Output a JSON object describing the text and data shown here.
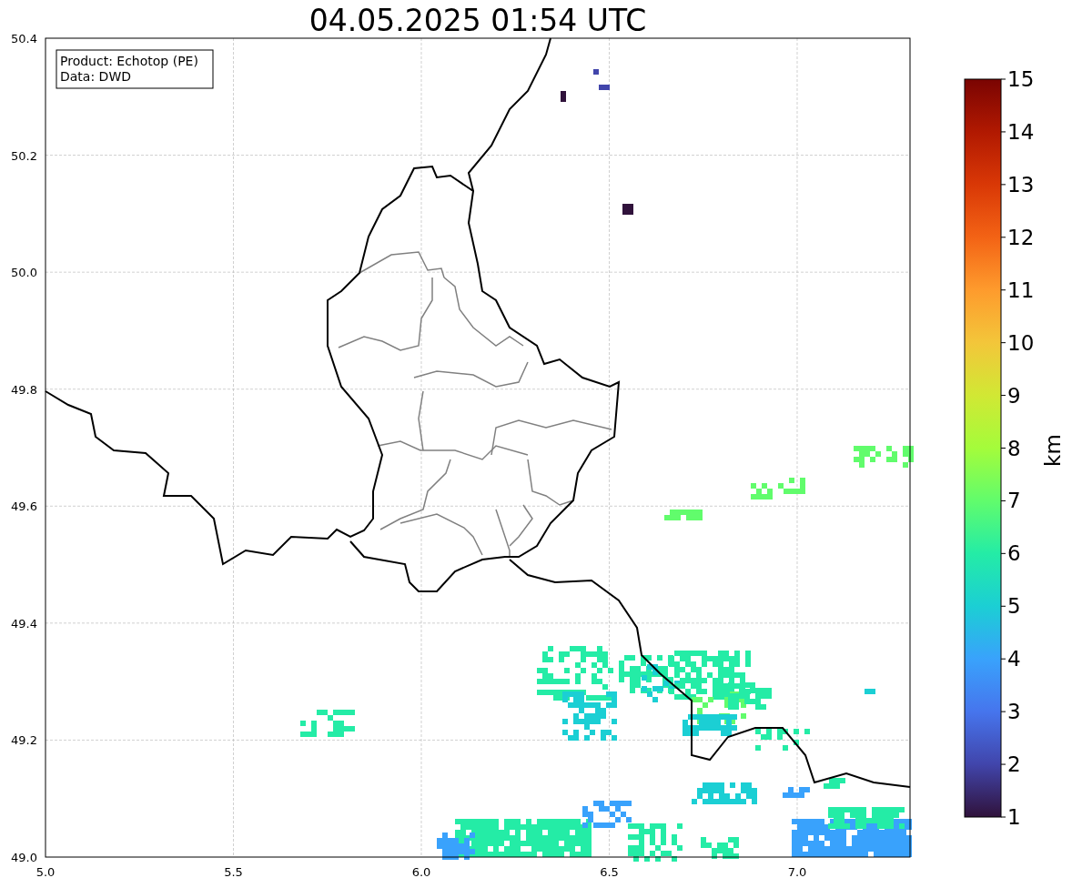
{
  "title": "04.05.2025 01:54 UTC",
  "info_box": [
    "Product: Echotop (PE)",
    "Data: DWD"
  ],
  "x_ticks": [
    "5.0",
    "5.5",
    "6.0",
    "6.5",
    "7.0"
  ],
  "y_ticks": [
    "50.4",
    "50.2",
    "50.0",
    "49.8",
    "49.6",
    "49.4",
    "49.2",
    "49.0"
  ],
  "colorbar": {
    "label": "km",
    "ticks": [
      "15",
      "14",
      "13",
      "12",
      "11",
      "10",
      "9",
      "8",
      "7",
      "6",
      "5",
      "4",
      "3",
      "2",
      "1"
    ]
  }
}
